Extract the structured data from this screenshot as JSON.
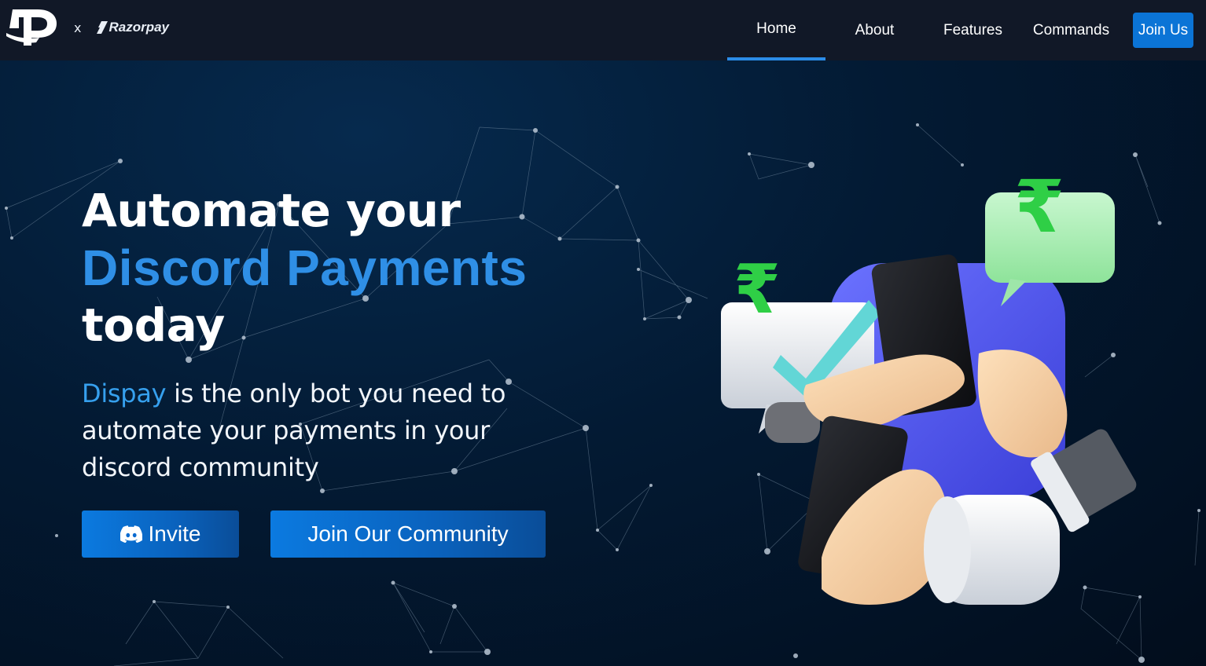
{
  "navbar": {
    "brand_separator": "x",
    "partner_name": "Razorpay",
    "links": [
      {
        "label": "Home",
        "active": true
      },
      {
        "label": "About",
        "active": false
      },
      {
        "label": "Features",
        "active": false
      },
      {
        "label": "Commands",
        "active": false
      }
    ],
    "join_label": "Join Us"
  },
  "hero": {
    "title_line1": "Automate your",
    "title_line2": "Discord Payments",
    "title_line3": "today",
    "subtitle_brand": "Dispay",
    "subtitle_rest": " is the only bot you need to automate your payments in your discord community",
    "invite_label": "Invite",
    "community_label": "Join Our Community"
  },
  "colors": {
    "nav_bg": "#111827",
    "accent": "#2f8fe6",
    "button": "#0b74d6",
    "hero_bg": "#031a33"
  },
  "icons": [
    "dispay-logo-icon",
    "razorpay-logo-icon",
    "discord-icon",
    "rupee-icon",
    "checkmark-icon"
  ]
}
